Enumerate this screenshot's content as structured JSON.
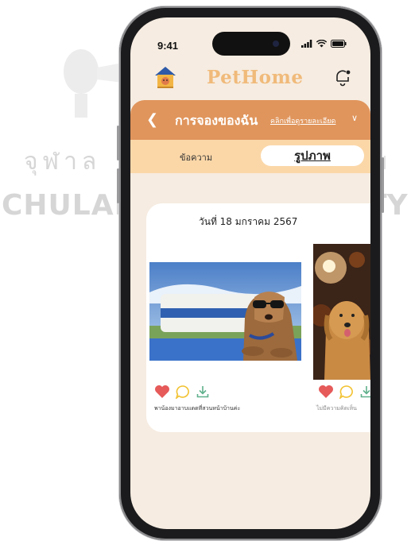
{
  "watermark": {
    "thai_text": "จุฬาล",
    "thai_right": "ย",
    "eng_left": "CHULAL",
    "eng_right": "TY"
  },
  "status_bar": {
    "time": "9:41"
  },
  "app": {
    "brand": "PetHome"
  },
  "header": {
    "title": "การจองของฉัน",
    "detail_link": "คลิกเพื่อดูรายละเอียด"
  },
  "tabs": {
    "message_label": "ข้อความ",
    "photo_label": "รูปภาพ"
  },
  "card": {
    "date": "วันที่ 18 มกราคม 2567",
    "posts": [
      {
        "caption": "พาน้องมาอาบแดดที่สวนหน้าบ้านค่ะ"
      },
      {
        "caption": "ไม่มีความคิดเห็น"
      }
    ]
  },
  "colors": {
    "accent": "#e0955c",
    "tab_bar": "#fbd7a8",
    "brand": "#f0ba7a",
    "background": "#f6ece1",
    "heart": "#e65a5a",
    "comment": "#f2c230",
    "download": "#5fb08c"
  }
}
